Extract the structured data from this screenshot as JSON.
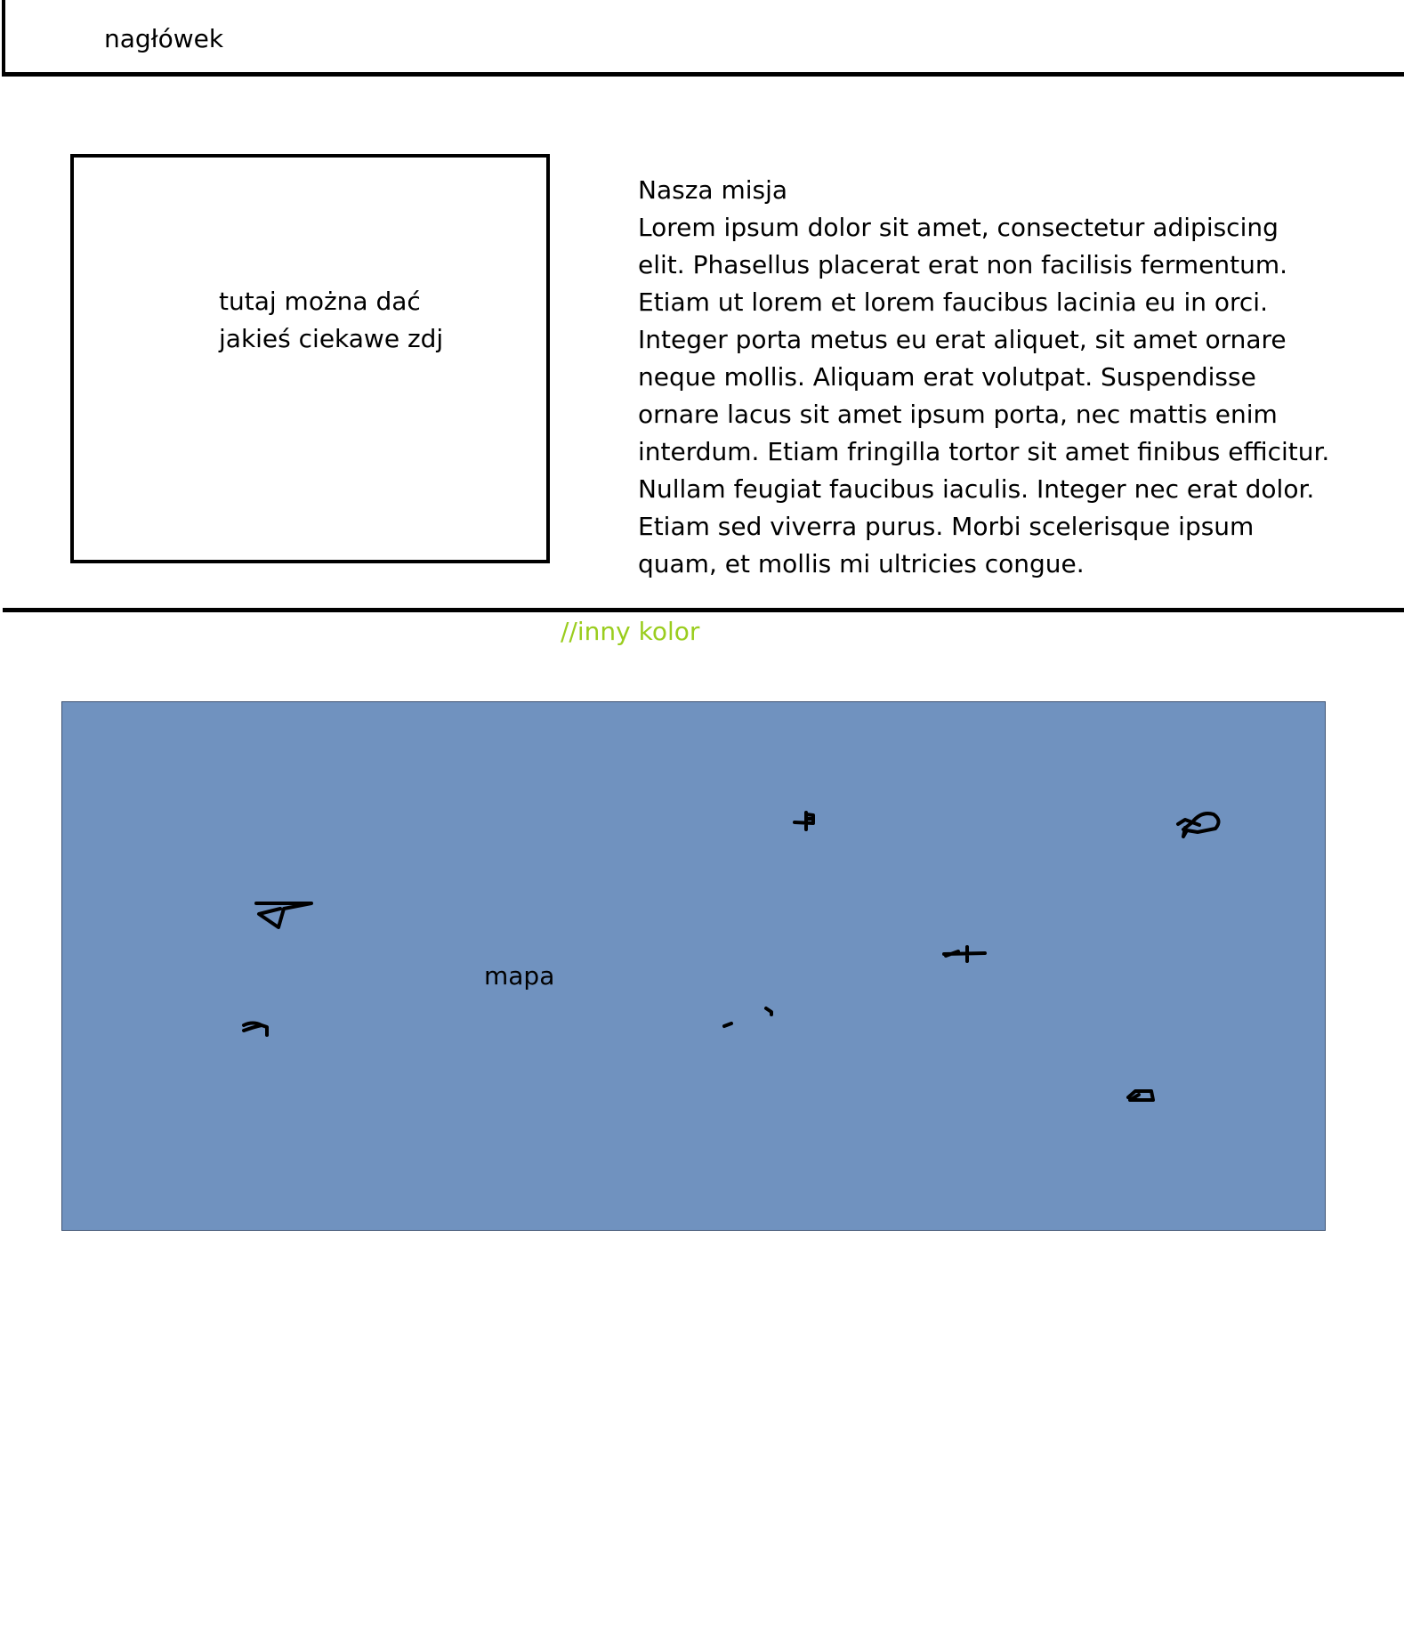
{
  "header": {
    "title": "nagłówek"
  },
  "image_placeholder": {
    "caption": "tutaj można dać jakieś ciekawe zdj"
  },
  "mission": {
    "title": "Nasza misja",
    "body": "Lorem ipsum dolor sit amet, consectetur adipiscing elit. Phasellus placerat erat non facilisis fermentum. Etiam ut lorem et lorem faucibus lacinia eu in orci. Integer porta metus eu erat aliquet, sit amet ornare neque mollis. Aliquam erat volutpat. Suspendisse ornare lacus sit amet ipsum porta, nec mattis enim interdum. Etiam fringilla tortor sit amet finibus efficitur. Nullam feugiat faucibus iaculis. Integer nec erat dolor. Etiam sed viverra purus. Morbi scelerisque ipsum quam, et mollis mi ultricies congue."
  },
  "note": {
    "text": "//inny kolor",
    "color": "#9acd1e"
  },
  "map": {
    "label": "mapa",
    "background_color": "#7092bf"
  }
}
